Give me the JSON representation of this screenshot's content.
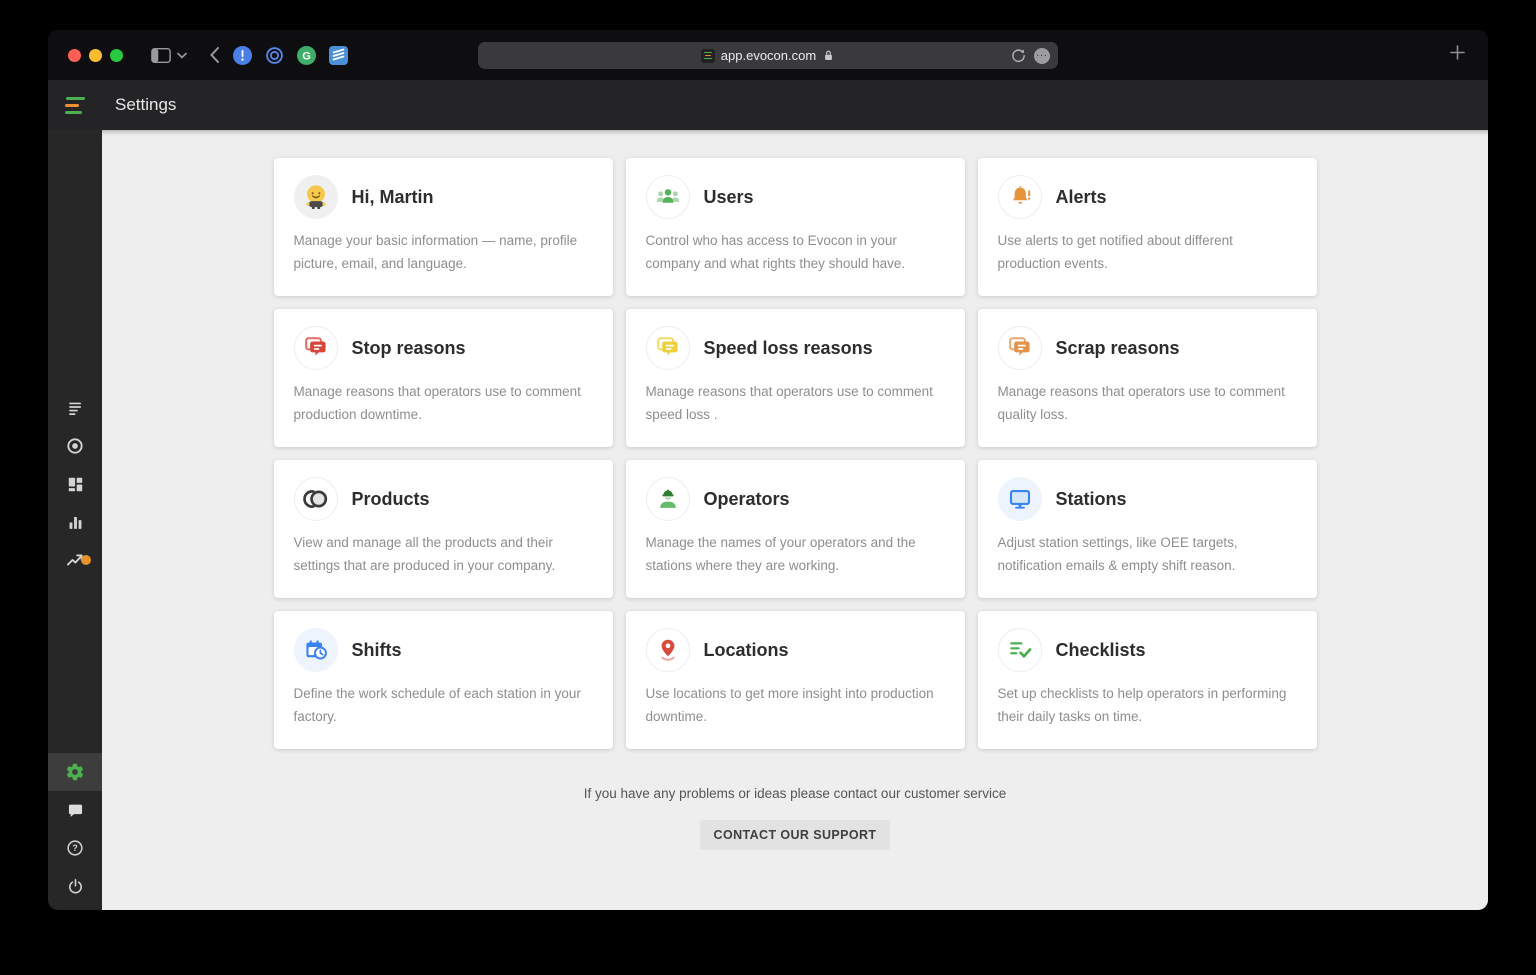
{
  "browser": {
    "url": "app.evocon.com",
    "extension_icons": [
      "alert-extension-icon",
      "onepassword-extension-icon",
      "grammarly-extension-icon",
      "notes-extension-icon"
    ]
  },
  "header": {
    "title": "Settings"
  },
  "sidebar": {
    "nav_icons": [
      "production-log-icon",
      "live-view-icon",
      "dashboard-icon",
      "reports-icon",
      "trends-icon"
    ],
    "trends_badge": "orange-dot",
    "bottom_icons": [
      "settings-gear-icon",
      "feedback-chat-icon",
      "help-icon",
      "logout-power-icon"
    ],
    "active_item": "settings"
  },
  "cards": [
    {
      "icon": "avatar-icon",
      "title": "Hi, Martin",
      "description": "Manage your basic information — name, profile picture, email, and language."
    },
    {
      "icon": "users-icon",
      "title": "Users",
      "description": "Control who has access to Evocon in your company and what rights they should have."
    },
    {
      "icon": "bell-icon",
      "title": "Alerts",
      "description": "Use alerts to get notified about different production events."
    },
    {
      "icon": "stop-reasons-icon",
      "title": "Stop reasons",
      "description": "Manage reasons that operators use to comment production downtime."
    },
    {
      "icon": "speed-loss-reasons-icon",
      "title": "Speed loss reasons",
      "description": "Manage reasons that operators use to comment speed loss ."
    },
    {
      "icon": "scrap-reasons-icon",
      "title": "Scrap reasons",
      "description": "Manage reasons that operators use to comment quality loss."
    },
    {
      "icon": "products-icon",
      "title": "Products",
      "description": "View and manage all the products and their settings that are produced in your company."
    },
    {
      "icon": "operators-icon",
      "title": "Operators",
      "description": "Manage the names of your operators and the stations where they are working."
    },
    {
      "icon": "stations-icon",
      "title": "Stations",
      "description": "Adjust station settings, like OEE targets, notification emails & empty shift reason."
    },
    {
      "icon": "shifts-icon",
      "title": "Shifts",
      "description": "Define the work schedule of each station in your factory."
    },
    {
      "icon": "locations-icon",
      "title": "Locations",
      "description": "Use locations to get more insight into production downtime."
    },
    {
      "icon": "checklists-icon",
      "title": "Checklists",
      "description": "Set up checklists to help operators in performing their daily tasks on time."
    }
  ],
  "footer": {
    "support_text": "If you have any problems or ideas please contact our customer service",
    "support_button": "CONTACT OUR SUPPORT"
  },
  "colors": {
    "accent_green": "#4caf50",
    "alert_orange": "#e8943a",
    "stop_red": "#d9453b",
    "speed_yellow": "#f0cf3e",
    "scrap_orange": "#e3924a",
    "blue": "#3b82f6",
    "location_red": "#d94a3d",
    "trend_badge_orange": "#e8922a"
  }
}
